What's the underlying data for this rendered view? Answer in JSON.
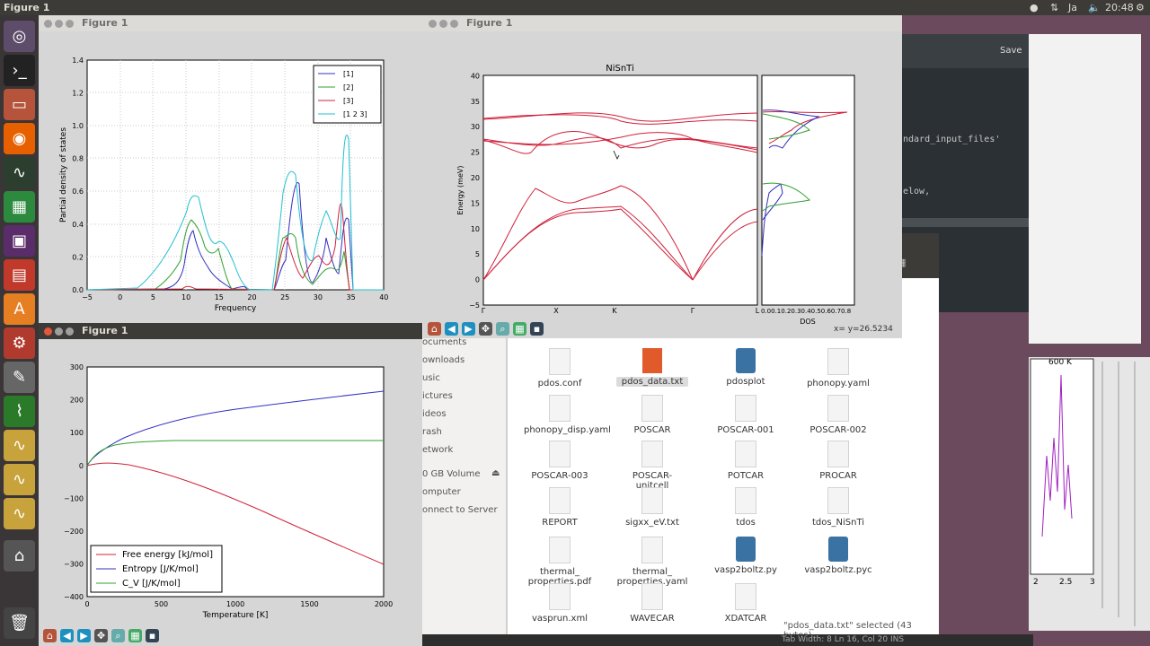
{
  "topbar": {
    "title": "Figure 1",
    "time": "20:48",
    "lang": "Ja"
  },
  "fig_pdos": {
    "title": "Figure 1",
    "ylabel": "Partial density of states",
    "xlabel": "Frequency",
    "xticks": [
      "−5",
      "0",
      "5",
      "10",
      "15",
      "20",
      "25",
      "30",
      "35",
      "40"
    ],
    "yticks": [
      "0.0",
      "0.2",
      "0.4",
      "0.6",
      "0.8",
      "1.0",
      "1.2",
      "1.4"
    ],
    "legend": [
      "[1]",
      "[2]",
      "[3]",
      "[1 2 3]"
    ]
  },
  "fig_band": {
    "title": "Figure 1",
    "plot_title": "NiSnTi",
    "ylabel": "Energy (meV)",
    "yticks": [
      "−5",
      "0",
      "5",
      "10",
      "15",
      "20",
      "25",
      "30",
      "35",
      "40"
    ],
    "xticks": [
      "Γ",
      "X",
      "K",
      "Γ",
      "L"
    ],
    "dos_label": "DOS",
    "dos_ticks": "0.00.10.20.30.40.50.60.70.8",
    "coord": "x= y=26.5234"
  },
  "fig_thermo": {
    "title": "Figure 1",
    "xlabel": "Temperature [K]",
    "xticks": [
      "0",
      "500",
      "1000",
      "1500",
      "2000"
    ],
    "yticks": [
      "300",
      "200",
      "100",
      "0",
      "−100",
      "−200",
      "−300",
      "−400"
    ],
    "legend": [
      "Free energy [kJ/mol]",
      "Entropy [J/K/mol]",
      "C_V [J/K/mol]"
    ]
  },
  "editor": {
    "save": "Save",
    "line1": "ndard_input_files'",
    "line2": "elow,"
  },
  "files": {
    "sidebar": [
      "ocuments",
      "ownloads",
      "usic",
      "ictures",
      "ideos",
      "rash",
      "etwork",
      "0 GB Volume",
      "omputer",
      "onnect to Server"
    ],
    "items": [
      {
        "name": "pdos.conf",
        "kind": "doc"
      },
      {
        "name": "pdos_data.txt",
        "kind": "txt"
      },
      {
        "name": "pdosplot",
        "kind": "py"
      },
      {
        "name": "phonopy.yaml",
        "kind": "doc"
      },
      {
        "name": "phonopy_disp.yaml",
        "kind": "doc"
      },
      {
        "name": "POSCAR",
        "kind": "doc"
      },
      {
        "name": "POSCAR-001",
        "kind": "doc"
      },
      {
        "name": "POSCAR-002",
        "kind": "doc"
      },
      {
        "name": "POSCAR-003",
        "kind": "doc"
      },
      {
        "name": "POSCAR-unitcell",
        "kind": "doc"
      },
      {
        "name": "POTCAR",
        "kind": "doc"
      },
      {
        "name": "PROCAR",
        "kind": "doc"
      },
      {
        "name": "REPORT",
        "kind": "doc"
      },
      {
        "name": "sigxx_eV.txt",
        "kind": "doc"
      },
      {
        "name": "tdos",
        "kind": "doc"
      },
      {
        "name": "tdos_NiSnTi",
        "kind": "doc"
      },
      {
        "name": "thermal_\nproperties.pdf",
        "kind": "doc"
      },
      {
        "name": "thermal_\nproperties.yaml",
        "kind": "doc"
      },
      {
        "name": "vasp2boltz.py",
        "kind": "py"
      },
      {
        "name": "vasp2boltz.pyc",
        "kind": "py"
      },
      {
        "name": "vasprun.xml",
        "kind": "doc"
      },
      {
        "name": "WAVECAR",
        "kind": "doc"
      },
      {
        "name": "XDATCAR",
        "kind": "doc"
      }
    ],
    "status": "\"pdos_data.txt\" selected  (43 bytes)"
  },
  "back_plot": {
    "label": "600 K",
    "xticks": [
      "2",
      "2.5",
      "3"
    ]
  },
  "status_bottom": "Tab Width: 8    Ln 16, Col 20    INS"
}
